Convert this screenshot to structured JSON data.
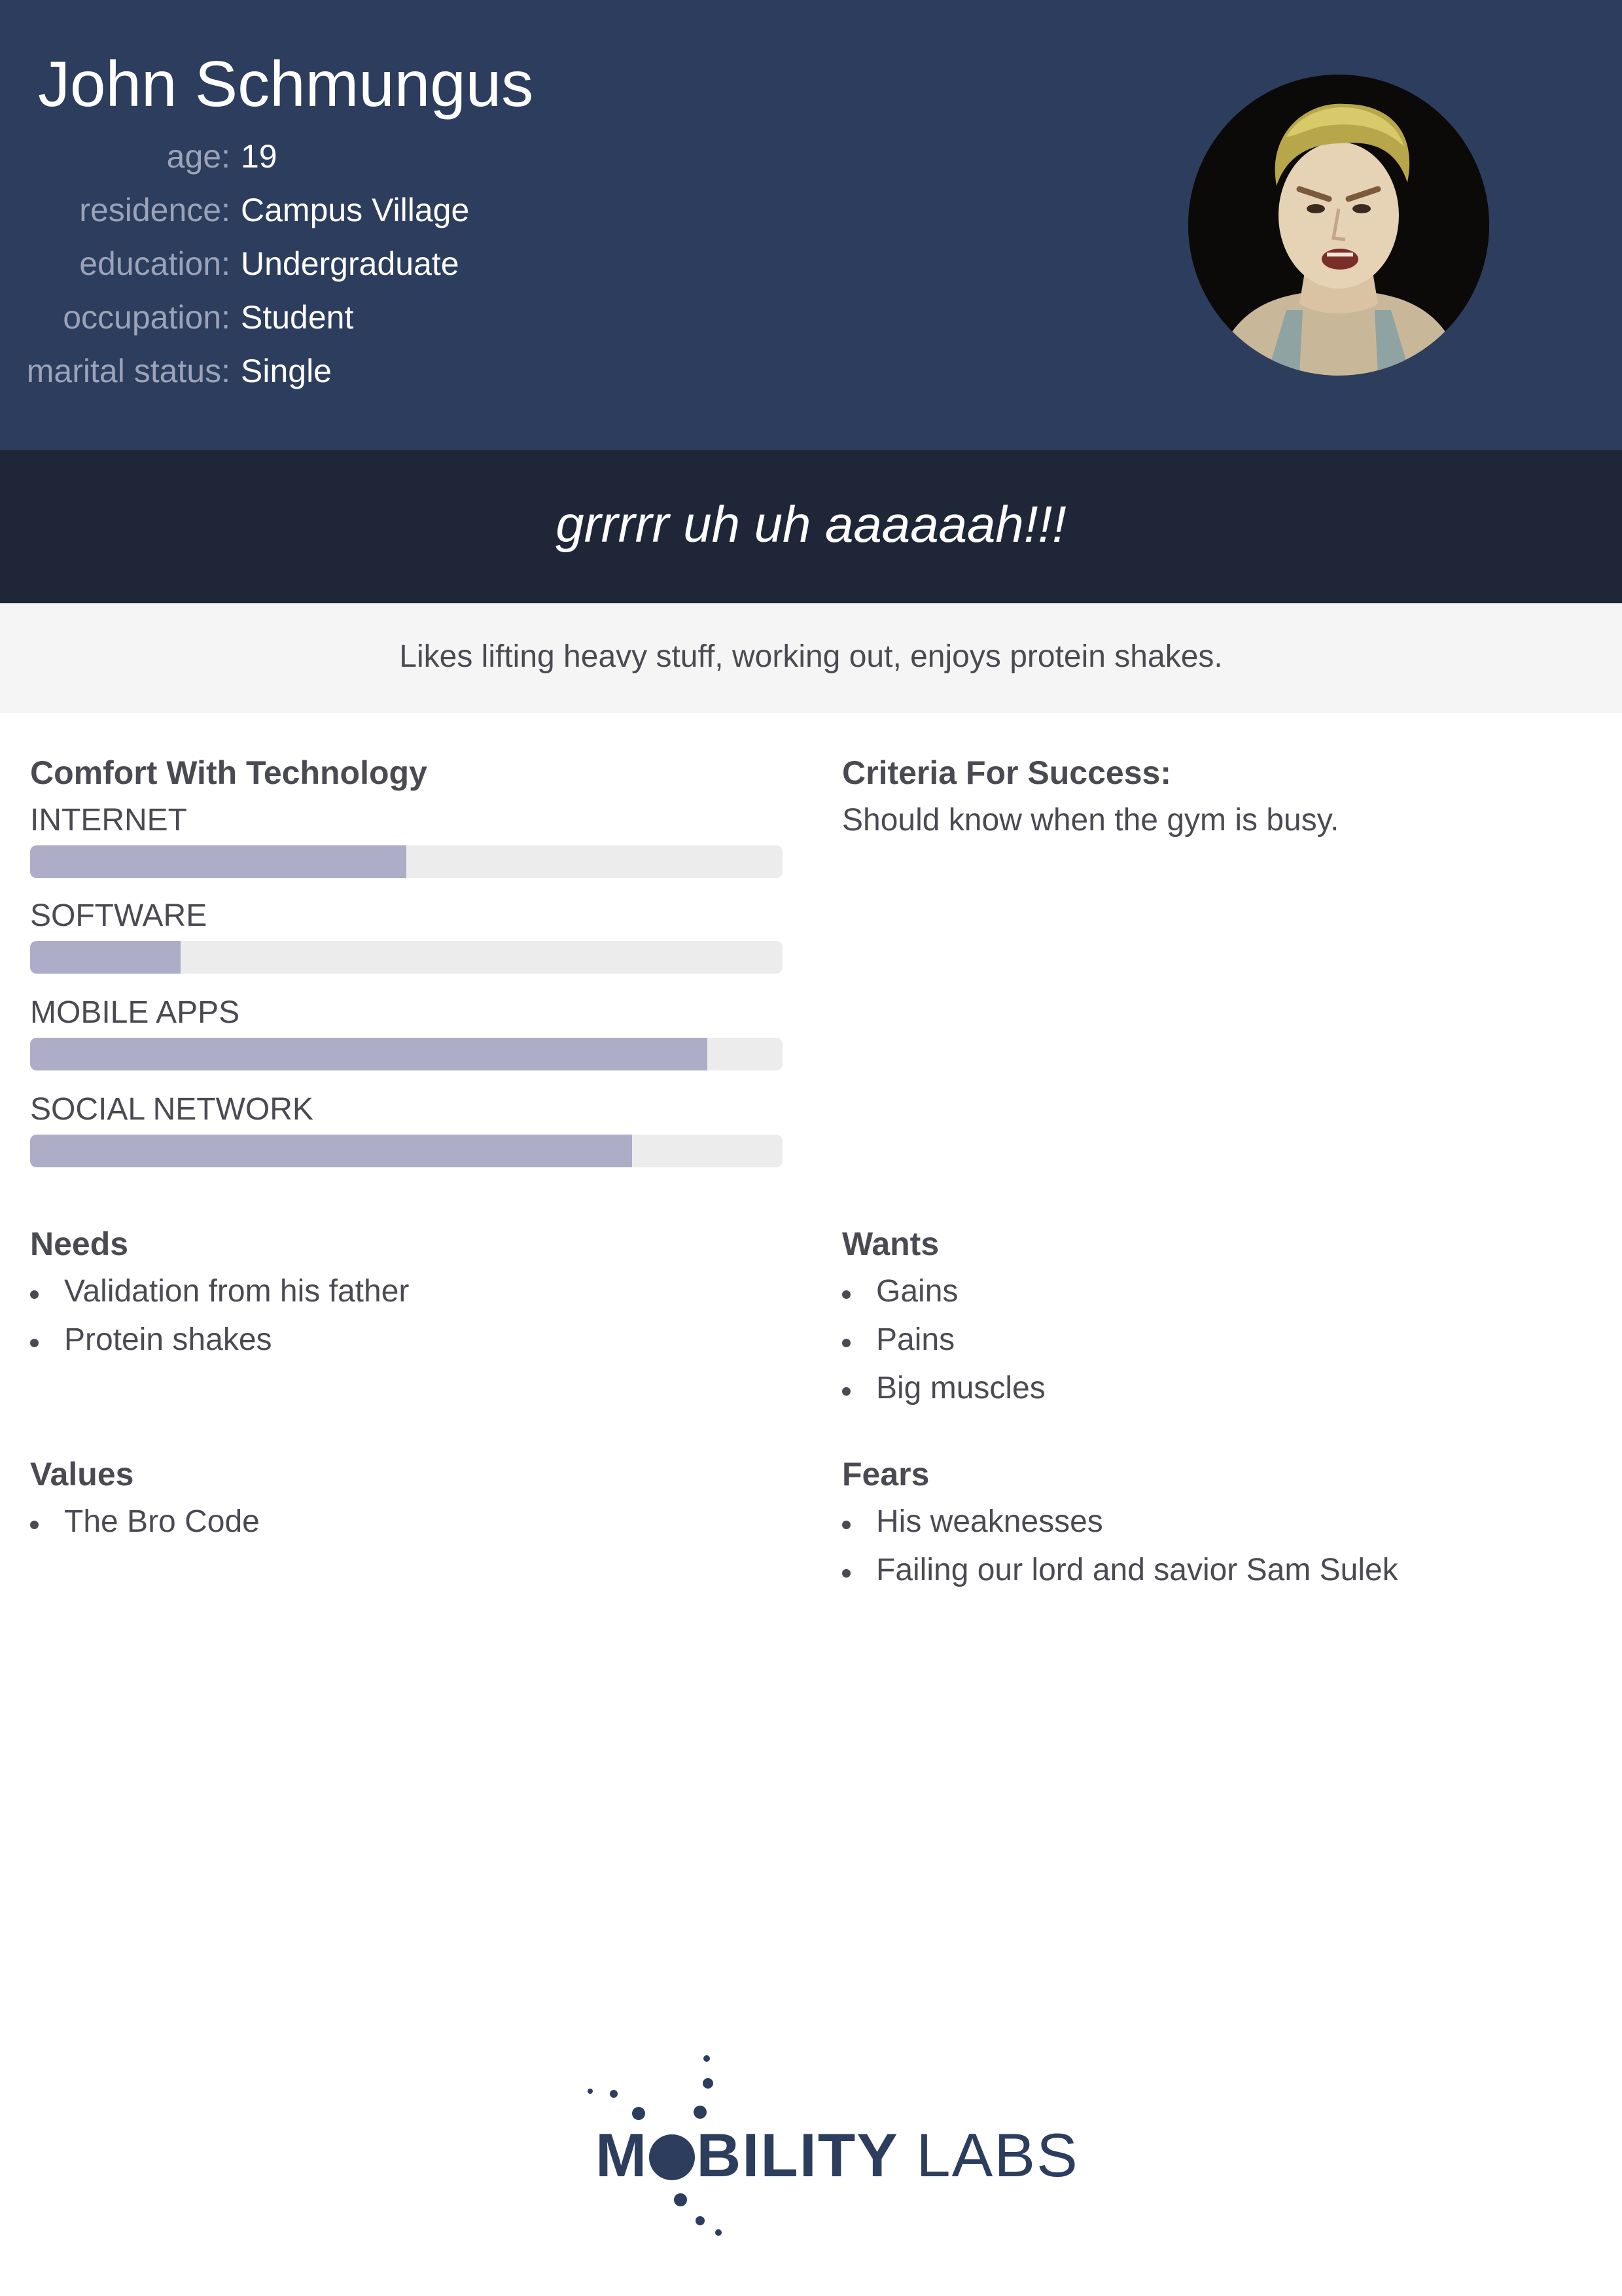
{
  "persona": {
    "name": "John Schmungus",
    "facts": [
      {
        "label": "age:",
        "value": "19"
      },
      {
        "label": "residence:",
        "value": "Campus Village"
      },
      {
        "label": "education:",
        "value": "Undergraduate"
      },
      {
        "label": "occupation:",
        "value": "Student"
      },
      {
        "label": "marital status:",
        "value": "Single"
      }
    ],
    "quote": "grrrrr uh uh aaaaaah!!!",
    "bio": "Likes lifting heavy stuff, working out, enjoys protein shakes."
  },
  "comfort": {
    "title": "Comfort With Technology",
    "items": [
      {
        "label": "INTERNET",
        "level": 0.5
      },
      {
        "label": "SOFTWARE",
        "level": 0.2
      },
      {
        "label": "MOBILE APPS",
        "level": 0.9
      },
      {
        "label": "SOCIAL NETWORK",
        "level": 0.8
      }
    ]
  },
  "criteria": {
    "title": "Criteria For Success:",
    "text": "Should know when the gym is busy."
  },
  "needs": {
    "title": "Needs",
    "items": [
      "Validation from his father",
      "Protein shakes"
    ]
  },
  "wants": {
    "title": "Wants",
    "items": [
      "Gains",
      "Pains",
      "Big muscles"
    ]
  },
  "values": {
    "title": "Values",
    "items": [
      "The Bro Code"
    ]
  },
  "fears": {
    "title": "Fears",
    "items": [
      "His weaknesses",
      "Failing our lord and savior Sam Sulek"
    ]
  },
  "logo": {
    "brand_part1": "M",
    "brand_part2": "BILITY",
    "brand_part3": "LABS"
  },
  "colors": {
    "header": "#2d3d5e",
    "quote_band": "#1e2638",
    "bio_band": "#f5f5f5",
    "bar_fill": "#aeadc7",
    "bar_track": "#ececec"
  }
}
